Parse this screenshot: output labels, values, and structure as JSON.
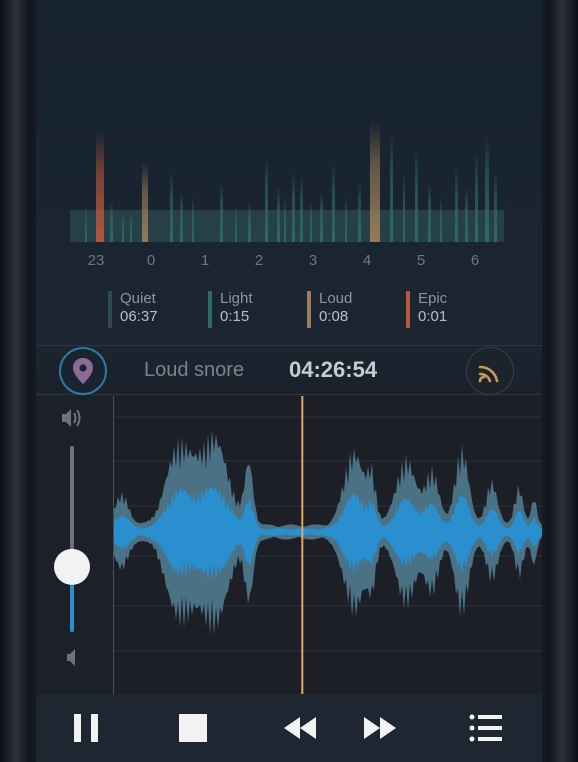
{
  "overview": {
    "hour_labels": [
      "23",
      "0",
      "1",
      "2",
      "3",
      "4",
      "5",
      "6"
    ],
    "colors": {
      "quiet": "#2d4b53",
      "light": "#2d6b6b",
      "loud": "#9a7e58",
      "epic": "#b8583d"
    }
  },
  "legend": [
    {
      "name": "Quiet",
      "time": "06:37",
      "color": "#2d4b53"
    },
    {
      "name": "Light",
      "time": "0:15",
      "color": "#2d6b6b"
    },
    {
      "name": "Loud",
      "time": "0:08",
      "color": "#9a7e58"
    },
    {
      "name": "Epic",
      "time": "0:01",
      "color": "#b8583d"
    }
  ],
  "event": {
    "name": "Loud snore",
    "time": "04:26:54",
    "pin_icon": "map-pin-icon",
    "signal_icon": "broadcast-icon"
  },
  "volume": {
    "level": 0.35,
    "up_icon": "speaker-loud-icon",
    "down_icon": "speaker-quiet-icon"
  },
  "waveform": {
    "playhead_fraction": 0.44,
    "colors": {
      "signal": "#2a8fcf",
      "envelope": "#5b8da6",
      "playhead": "#e0a85f"
    }
  },
  "toolbar": {
    "pause_icon": "pause-icon",
    "stop_icon": "stop-icon",
    "rewind_icon": "rewind-icon",
    "forward_icon": "fast-forward-icon",
    "list_icon": "list-icon"
  }
}
